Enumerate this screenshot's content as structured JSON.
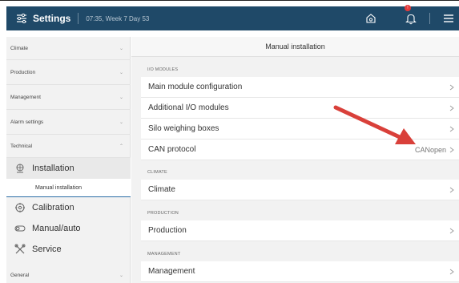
{
  "header": {
    "title": "Settings",
    "datetime": "07:35, Week 7 Day 53",
    "notification_count": "!",
    "colors": {
      "bar": "#1f4968",
      "alert": "#e53b3b"
    }
  },
  "sidebar": {
    "categories": [
      {
        "label": "Climate"
      },
      {
        "label": "Production"
      },
      {
        "label": "Management"
      },
      {
        "label": "Alarm settings"
      },
      {
        "label": "Technical"
      }
    ],
    "technical_items": [
      {
        "label": "Installation",
        "icon": "installation-icon"
      },
      {
        "label": "Manual installation",
        "active": true
      },
      {
        "label": "Calibration",
        "icon": "calibration-icon"
      },
      {
        "label": "Manual/auto",
        "icon": "toggle-icon"
      },
      {
        "label": "Service",
        "icon": "tools-icon"
      }
    ],
    "bottom_category": {
      "label": "General"
    }
  },
  "main": {
    "title": "Manual installation",
    "sections": [
      {
        "label": "I/O MODULES",
        "rows": [
          {
            "label": "Main module configuration",
            "value": ""
          },
          {
            "label": "Additional I/O modules",
            "value": ""
          },
          {
            "label": "Silo weighing boxes",
            "value": ""
          },
          {
            "label": "CAN protocol",
            "value": "CANopen"
          }
        ]
      },
      {
        "label": "CLIMATE",
        "rows": [
          {
            "label": "Climate",
            "value": ""
          }
        ]
      },
      {
        "label": "PRODUCTION",
        "rows": [
          {
            "label": "Production",
            "value": ""
          }
        ]
      },
      {
        "label": "MANAGEMENT",
        "rows": [
          {
            "label": "Management",
            "value": ""
          }
        ]
      }
    ],
    "annotation_color": "#d9403a"
  }
}
